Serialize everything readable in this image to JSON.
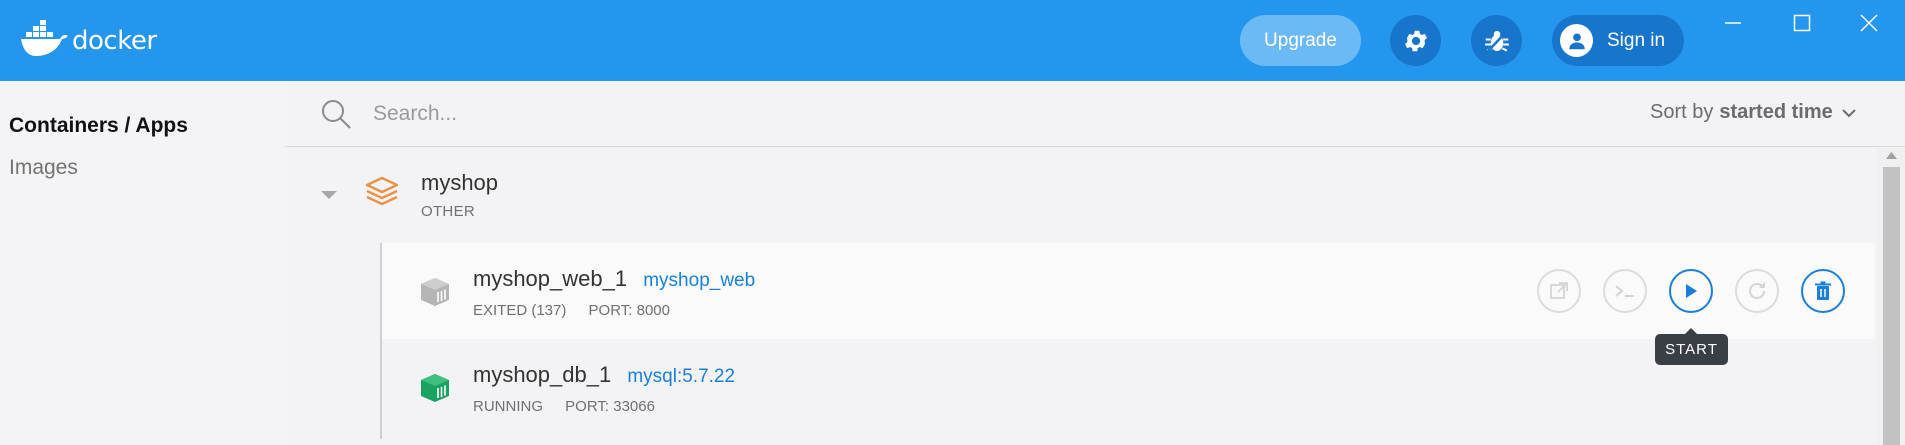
{
  "app": {
    "name": "docker"
  },
  "header": {
    "upgrade_label": "Upgrade",
    "signin_label": "Sign in",
    "icons": [
      "settings-gear-icon",
      "bug-icon",
      "user-avatar-icon",
      "minimize-icon",
      "maximize-icon",
      "close-icon"
    ]
  },
  "sidebar": {
    "items": [
      {
        "label": "Containers / Apps",
        "active": true
      },
      {
        "label": "Images",
        "active": false
      }
    ]
  },
  "search": {
    "placeholder": "Search..."
  },
  "sort": {
    "prefix": "Sort by",
    "value": "started time"
  },
  "groups": [
    {
      "name": "myshop",
      "type": "OTHER",
      "containers": [
        {
          "name": "myshop_web_1",
          "image": "myshop_web",
          "status": "EXITED (137)",
          "port": "PORT: 8000"
        },
        {
          "name": "myshop_db_1",
          "image": "mysql:5.7.22",
          "status": "RUNNING",
          "port": "PORT: 33066"
        }
      ]
    }
  ],
  "tooltip": {
    "text": "START"
  },
  "colors": {
    "header": "#2496ed",
    "accent_blue": "#1a7fd8",
    "running_green": "#1aa260",
    "stopped_gray": "#b5b5b5",
    "stack_orange": "#e8924a"
  }
}
